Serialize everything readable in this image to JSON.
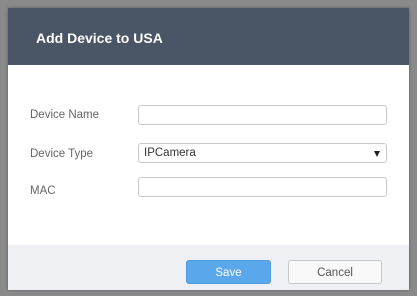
{
  "dialog": {
    "title": "Add Device to USA"
  },
  "form": {
    "device_name": {
      "label": "Device Name",
      "value": ""
    },
    "device_type": {
      "label": "Device Type",
      "value": "IPCamera"
    },
    "mac": {
      "label": "MAC",
      "value": ""
    }
  },
  "footer": {
    "save_label": "Save",
    "cancel_label": "Cancel"
  },
  "icons": {
    "select_arrow": "chevron-down-icon"
  },
  "colors": {
    "header_bg": "#4a5665",
    "save_bg": "#5aa7ec",
    "footer_bg": "#eef0f3"
  }
}
